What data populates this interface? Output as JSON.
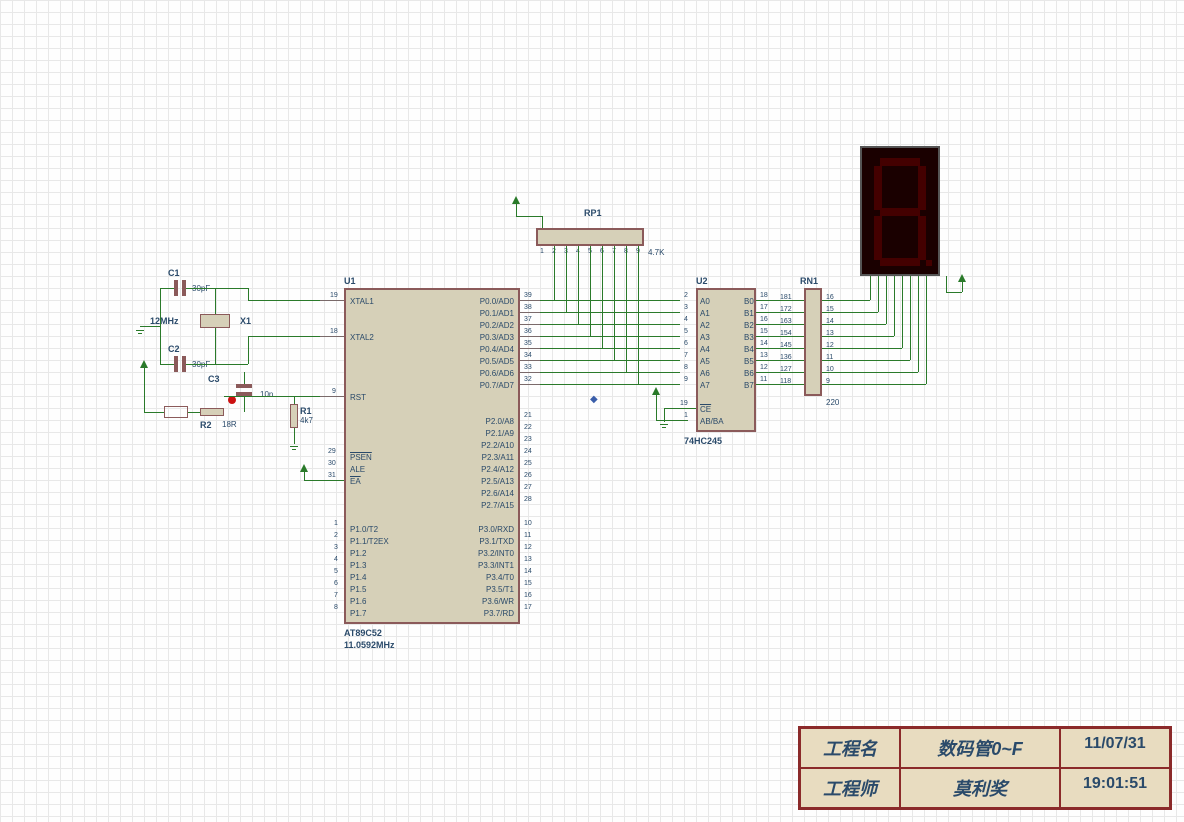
{
  "u1": {
    "ref": "U1",
    "part": "AT89C52",
    "freq": "11.0592MHz",
    "pins_left": [
      {
        "num": "19",
        "name": "XTAL1"
      },
      {
        "num": "18",
        "name": "XTAL2"
      },
      {
        "num": "9",
        "name": "RST"
      },
      {
        "num": "29",
        "name": "PSEN",
        "bar": true
      },
      {
        "num": "30",
        "name": "ALE"
      },
      {
        "num": "31",
        "name": "EA",
        "bar": true
      },
      {
        "num": "1",
        "name": "P1.0/T2"
      },
      {
        "num": "2",
        "name": "P1.1/T2EX"
      },
      {
        "num": "3",
        "name": "P1.2"
      },
      {
        "num": "4",
        "name": "P1.3"
      },
      {
        "num": "5",
        "name": "P1.4"
      },
      {
        "num": "6",
        "name": "P1.5"
      },
      {
        "num": "7",
        "name": "P1.6"
      },
      {
        "num": "8",
        "name": "P1.7"
      }
    ],
    "pins_right_p0": [
      {
        "num": "39",
        "name": "P0.0/AD0"
      },
      {
        "num": "38",
        "name": "P0.1/AD1"
      },
      {
        "num": "37",
        "name": "P0.2/AD2"
      },
      {
        "num": "36",
        "name": "P0.3/AD3"
      },
      {
        "num": "35",
        "name": "P0.4/AD4"
      },
      {
        "num": "34",
        "name": "P0.5/AD5"
      },
      {
        "num": "33",
        "name": "P0.6/AD6"
      },
      {
        "num": "32",
        "name": "P0.7/AD7"
      }
    ],
    "pins_right_p2": [
      {
        "num": "21",
        "name": "P2.0/A8"
      },
      {
        "num": "22",
        "name": "P2.1/A9"
      },
      {
        "num": "23",
        "name": "P2.2/A10"
      },
      {
        "num": "24",
        "name": "P2.3/A11"
      },
      {
        "num": "25",
        "name": "P2.4/A12"
      },
      {
        "num": "26",
        "name": "P2.5/A13"
      },
      {
        "num": "27",
        "name": "P2.6/A14"
      },
      {
        "num": "28",
        "name": "P2.7/A15"
      }
    ],
    "pins_right_p3": [
      {
        "num": "10",
        "name": "P3.0/RXD"
      },
      {
        "num": "11",
        "name": "P3.1/TXD"
      },
      {
        "num": "12",
        "name": "P3.2/INT0",
        "bar": true
      },
      {
        "num": "13",
        "name": "P3.3/INT1",
        "bar": true
      },
      {
        "num": "14",
        "name": "P3.4/T0"
      },
      {
        "num": "15",
        "name": "P3.5/T1"
      },
      {
        "num": "16",
        "name": "P3.6/WR",
        "bar": true
      },
      {
        "num": "17",
        "name": "P3.7/RD",
        "bar": true
      }
    ]
  },
  "u2": {
    "ref": "U2",
    "part": "74HC245",
    "pins_left": [
      {
        "num": "2",
        "name": "A0"
      },
      {
        "num": "3",
        "name": "A1"
      },
      {
        "num": "4",
        "name": "A2"
      },
      {
        "num": "5",
        "name": "A3"
      },
      {
        "num": "6",
        "name": "A4"
      },
      {
        "num": "7",
        "name": "A5"
      },
      {
        "num": "8",
        "name": "A6"
      },
      {
        "num": "9",
        "name": "A7"
      },
      {
        "num": "19",
        "name": "CE",
        "bar": true
      },
      {
        "num": "1",
        "name": "AB/BA",
        "bar": true
      }
    ],
    "pins_right": [
      {
        "num": "18",
        "name": "B0"
      },
      {
        "num": "17",
        "name": "B1"
      },
      {
        "num": "16",
        "name": "B2"
      },
      {
        "num": "15",
        "name": "B3"
      },
      {
        "num": "14",
        "name": "B4"
      },
      {
        "num": "13",
        "name": "B5"
      },
      {
        "num": "12",
        "name": "B6"
      },
      {
        "num": "11",
        "name": "B7"
      }
    ],
    "rn_nums_left": [
      "181",
      "172",
      "163",
      "154",
      "145",
      "136",
      "127",
      "118"
    ],
    "rn_nums_right": [
      "16",
      "15",
      "14",
      "13",
      "12",
      "11",
      "10",
      "9"
    ]
  },
  "rp1": {
    "ref": "RP1",
    "val": "4.7K",
    "pins": [
      "1",
      "2",
      "3",
      "4",
      "5",
      "6",
      "7",
      "8",
      "9"
    ]
  },
  "rn1": {
    "ref": "RN1",
    "val": "220"
  },
  "passives": {
    "c1": {
      "ref": "C1",
      "val": "30pF"
    },
    "c2": {
      "ref": "C2",
      "val": "30pF"
    },
    "c3": {
      "ref": "C3",
      "val": "10n"
    },
    "x1": {
      "ref": "X1",
      "val": "12MHz"
    },
    "r1": {
      "ref": "R1",
      "val": "4k7"
    },
    "r2": {
      "ref": "R2",
      "val": "18R"
    }
  },
  "title_block": {
    "row1": {
      "l": "工程名",
      "c": "数码管0~F",
      "r": "11/07/31"
    },
    "row2": {
      "l": "工程师",
      "c": "莫利奖",
      "r": "19:01:51"
    }
  },
  "marker": "◆"
}
